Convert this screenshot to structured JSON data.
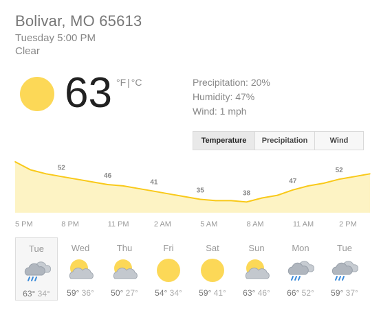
{
  "location": "Bolivar, MO 65613",
  "datetime": "Tuesday 5:00 PM",
  "condition": "Clear",
  "current": {
    "temperature": "63",
    "unit_f": "°F",
    "unit_sep": "|",
    "unit_c": "°C",
    "icon": "sun-icon"
  },
  "details": {
    "precipitation": "Precipitation: 20%",
    "humidity": "Humidity: 47%",
    "wind": "Wind: 1 mph"
  },
  "tabs": [
    {
      "label": "Temperature",
      "active": true
    },
    {
      "label": "Precipitation",
      "active": false
    },
    {
      "label": "Wind",
      "active": false
    }
  ],
  "colors": {
    "accent_line": "#f9c919",
    "area_fill": "#fdf3c4",
    "sun": "#fcd857"
  },
  "chart_data": {
    "type": "area",
    "x": [
      "5 PM",
      "6 PM",
      "7 PM",
      "8 PM",
      "9 PM",
      "10 PM",
      "11 PM",
      "12 AM",
      "1 AM",
      "2 AM",
      "3 AM",
      "4 AM",
      "5 AM",
      "6 AM",
      "7 AM",
      "8 AM",
      "9 AM",
      "10 AM",
      "11 AM",
      "12 PM",
      "1 PM",
      "2 PM",
      "3 PM",
      "4 PM"
    ],
    "series": [
      {
        "values": [
          63,
          57,
          54,
          52,
          50,
          48,
          46,
          45,
          43,
          41,
          39,
          37,
          35,
          34,
          34,
          33,
          36,
          38,
          42,
          45,
          47,
          50,
          52,
          54
        ]
      }
    ],
    "data_labels": [
      {
        "x": "5 PM",
        "value": "63"
      },
      {
        "x": "8 PM",
        "value": "52"
      },
      {
        "x": "11 PM",
        "value": "46"
      },
      {
        "x": "2 AM",
        "value": "41"
      },
      {
        "x": "5 AM",
        "value": "35"
      },
      {
        "x": "8 AM",
        "value": "38"
      },
      {
        "x": "11 AM",
        "value": "47"
      },
      {
        "x": "2 PM",
        "value": "52"
      }
    ],
    "tick_labels": [
      "5 PM",
      "8 PM",
      "11 PM",
      "2 AM",
      "5 AM",
      "8 AM",
      "11 AM",
      "2 PM"
    ],
    "ylim": [
      25,
      68
    ],
    "grid": false
  },
  "forecast": [
    {
      "day": "Tue",
      "high": "63°",
      "low": "34°",
      "icon": "rain-cloud-icon",
      "active": true
    },
    {
      "day": "Wed",
      "high": "59°",
      "low": "36°",
      "icon": "partly-cloudy-icon",
      "active": false
    },
    {
      "day": "Thu",
      "high": "50°",
      "low": "27°",
      "icon": "partly-cloudy-icon",
      "active": false
    },
    {
      "day": "Fri",
      "high": "54°",
      "low": "34°",
      "icon": "sun-icon",
      "active": false
    },
    {
      "day": "Sat",
      "high": "59°",
      "low": "41°",
      "icon": "sun-icon",
      "active": false
    },
    {
      "day": "Sun",
      "high": "63°",
      "low": "46°",
      "icon": "partly-cloudy-icon",
      "active": false
    },
    {
      "day": "Mon",
      "high": "66°",
      "low": "52°",
      "icon": "rain-cloud-icon",
      "active": false
    },
    {
      "day": "Tue",
      "high": "59°",
      "low": "37°",
      "icon": "rain-cloud-icon",
      "active": false
    }
  ]
}
